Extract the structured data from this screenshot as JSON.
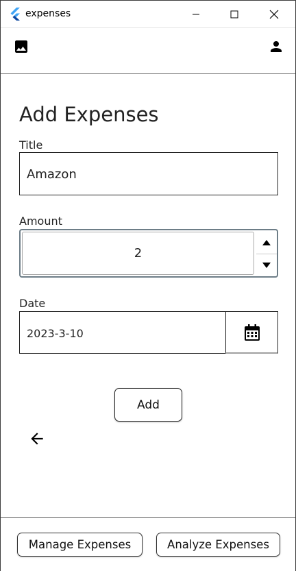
{
  "window": {
    "title": "expenses"
  },
  "form": {
    "heading": "Add Expenses",
    "title_label": "Title",
    "title_value": "Amazon",
    "amount_label": "Amount",
    "amount_value": "2",
    "date_label": "Date",
    "date_value": "2023-3-10",
    "add_label": "Add"
  },
  "footer": {
    "manage_label": "Manage Expenses",
    "analyze_label": "Analyze Expenses"
  },
  "icons": {
    "app_logo": "flutter-logo-icon",
    "image": "image-icon",
    "profile": "person-icon",
    "calendar": "calendar-icon",
    "back": "arrow-left-icon",
    "spin_up": "triangle-up-icon",
    "spin_down": "triangle-down-icon"
  },
  "colors": {
    "logo_light": "#42a5f5",
    "logo_dark": "#0d47a1",
    "amount_focus_border": "#6d7d87"
  }
}
